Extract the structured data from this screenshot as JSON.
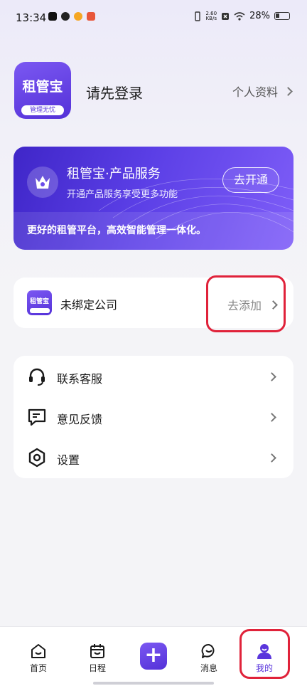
{
  "status_bar": {
    "time": "13:34",
    "net_speed_value": "2.60",
    "net_speed_unit": "KB/s",
    "battery": "28%"
  },
  "header": {
    "logo_main": "租管宝",
    "logo_sub": "管理无忧",
    "login_prompt": "请先登录",
    "profile_link": "个人资料"
  },
  "service_card": {
    "title": "租管宝·产品服务",
    "subtitle": "开通产品服务享受更多功能",
    "button": "去开通",
    "slogan": "更好的租管平台，高效智能管理一体化。"
  },
  "company": {
    "logo_text": "租管宝",
    "name": "未绑定公司",
    "action": "去添加"
  },
  "menu": [
    {
      "label": "联系客服",
      "icon": "headset-icon"
    },
    {
      "label": "意见反馈",
      "icon": "feedback-icon"
    },
    {
      "label": "设置",
      "icon": "settings-icon"
    }
  ],
  "tabbar": {
    "tabs": [
      {
        "label": "首页",
        "icon": "home-icon"
      },
      {
        "label": "日程",
        "icon": "calendar-icon"
      },
      {
        "label": "消息",
        "icon": "message-icon"
      },
      {
        "label": "我的",
        "icon": "user-icon"
      }
    ],
    "active": "我的",
    "plus": "+"
  },
  "colors": {
    "brand": "#5a36dc",
    "highlight": "#e0223a"
  }
}
